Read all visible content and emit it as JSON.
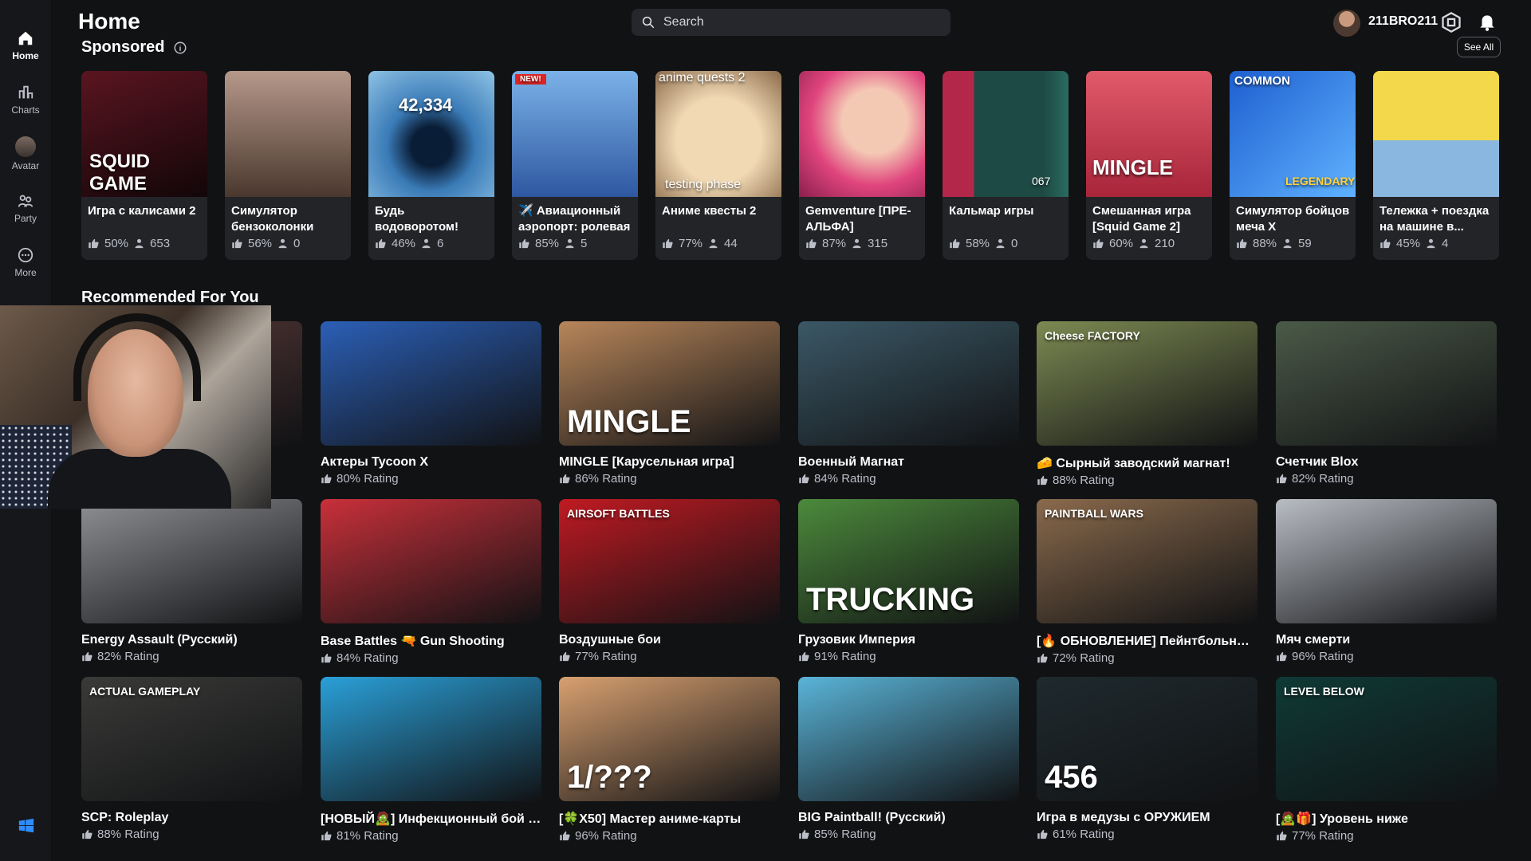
{
  "sidebar": {
    "items": [
      {
        "label": "Home",
        "icon": "home-icon"
      },
      {
        "label": "Charts",
        "icon": "charts-icon"
      },
      {
        "label": "Avatar",
        "icon": "avatar-icon"
      },
      {
        "label": "Party",
        "icon": "party-icon"
      },
      {
        "label": "More",
        "icon": "more-icon"
      }
    ]
  },
  "header": {
    "title": "Home",
    "search_placeholder": "Search",
    "username": "211BRO211"
  },
  "sponsored": {
    "title": "Sponsored",
    "see_all": "See All",
    "items": [
      {
        "title": "Игра с калисами 2",
        "rating": "50%",
        "players": "653",
        "thumb_text": "SQUID GAME",
        "color": "#2a0f14"
      },
      {
        "title": "Симулятор бензоколонки",
        "rating": "56%",
        "players": "0",
        "thumb_text": "",
        "color": "#7a5a48"
      },
      {
        "title": "Будь водоворотом!",
        "rating": "46%",
        "players": "6",
        "thumb_text": "42,334",
        "color": "#2d5d8c"
      },
      {
        "title": "✈️ Авиационный аэропорт: ролевая",
        "rating": "85%",
        "players": "5",
        "thumb_text": "NEW!",
        "color": "#3f6fb5"
      },
      {
        "title": "Аниме квесты 2",
        "rating": "77%",
        "players": "44",
        "thumb_text": "anime quests 2",
        "thumb_text_2": "testing phase",
        "color": "#d9c8b0"
      },
      {
        "title": "Gemventure [ПРЕ-АЛЬФА]",
        "rating": "87%",
        "players": "315",
        "thumb_text": "",
        "color": "#e0457d"
      },
      {
        "title": "Кальмар игры",
        "rating": "58%",
        "players": "0",
        "thumb_text": "067",
        "color": "#1e4a45"
      },
      {
        "title": "Смешанная игра [Squid Game 2]",
        "rating": "60%",
        "players": "210",
        "thumb_text": "MINGLE",
        "color": "#c23a4d"
      },
      {
        "title": "Симулятор бойцов меча X",
        "rating": "88%",
        "players": "59",
        "thumb_text": "COMMON",
        "thumb_text_2": "LEGENDARY",
        "color": "#2a7ad8"
      },
      {
        "title": "Тележка + поездка на машине в...",
        "rating": "45%",
        "players": "4",
        "thumb_text": "",
        "color": "#e6c53a"
      }
    ]
  },
  "recommended": {
    "title": "Recommended For You",
    "rows": [
      [
        {
          "title": "",
          "rating": "",
          "thumb_text": "",
          "color": "#5a3a3a"
        },
        {
          "title": "Актеры Tycoon X",
          "rating": "80% Rating",
          "thumb_text": "",
          "color": "#2b5fb6"
        },
        {
          "title": "MINGLE [Карусельная игра]",
          "rating": "86% Rating",
          "thumb_text": "MINGLE",
          "color": "#b8865a"
        },
        {
          "title": "Военный Магнат",
          "rating": "84% Rating",
          "thumb_text": "",
          "color": "#3b5866"
        },
        {
          "title": "🧀 Сырный заводский магнат!",
          "rating": "88% Rating",
          "thumb_text": "Cheese FACTORY",
          "color": "#7d8a52"
        },
        {
          "title": "Счетчик Blox",
          "rating": "82% Rating",
          "thumb_text": "",
          "color": "#4b5a48"
        }
      ],
      [
        {
          "title": "Energy Assault (Русский)",
          "rating": "82% Rating",
          "thumb_text": "",
          "color": "#8e9094"
        },
        {
          "title": "Base Battles 🔫 Gun Shooting",
          "rating": "84% Rating",
          "thumb_text": "",
          "color": "#c9303a"
        },
        {
          "title": "Воздушные бои",
          "rating": "77% Rating",
          "thumb_text": "AIRSOFT BATTLES",
          "color": "#c01a22"
        },
        {
          "title": "Грузовик Империя",
          "rating": "91% Rating",
          "thumb_text": "TRUCKING",
          "color": "#4c8a3c"
        },
        {
          "title": "[🔥 ОБНОВЛЕНИЕ] Пейнтбольные...",
          "rating": "72% Rating",
          "thumb_text": "PAINTBALL WARS",
          "color": "#8a6a4c"
        },
        {
          "title": "Мяч смерти",
          "rating": "96% Rating",
          "thumb_text": "",
          "color": "#b9bdc4"
        }
      ],
      [
        {
          "title": "SCP: Roleplay",
          "rating": "88% Rating",
          "thumb_text": "ACTUAL GAMEPLAY",
          "color": "#3a3a38"
        },
        {
          "title": "[НОВЫЙ🧟] Инфекционный бой с...",
          "rating": "81% Rating",
          "thumb_text": "",
          "color": "#2aa0d8"
        },
        {
          "title": "[🍀X50] Мастер аниме-карты",
          "rating": "96% Rating",
          "thumb_text": "1/???",
          "color": "#d8a070"
        },
        {
          "title": "BIG Paintball! (Русский)",
          "rating": "85% Rating",
          "thumb_text": "",
          "color": "#5ab4d8"
        },
        {
          "title": "Игра в медузы с ОРУЖИЕМ",
          "rating": "61% Rating",
          "thumb_text": "456",
          "color": "#1f2a2e"
        },
        {
          "title": "[🧟🎁] Уровень ниже",
          "rating": "77% Rating",
          "thumb_text": "LEVEL BELOW",
          "color": "#0f3a36"
        }
      ]
    ]
  }
}
